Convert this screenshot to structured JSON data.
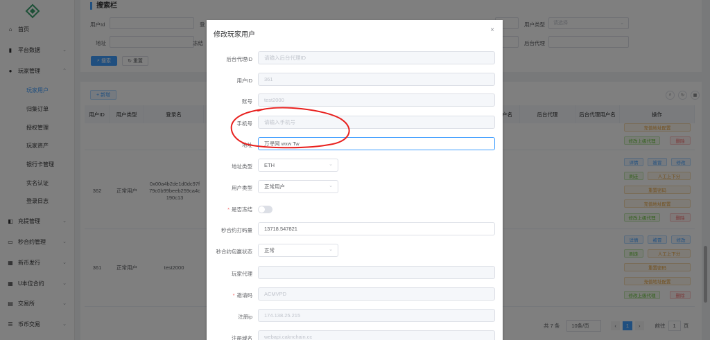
{
  "sidebar": {
    "items": [
      {
        "label": "首页",
        "icon": "home-icon",
        "glyph": "⌂"
      },
      {
        "label": "平台数据",
        "icon": "data-icon",
        "glyph": "▮"
      },
      {
        "label": "玩家管理",
        "icon": "user-icon",
        "glyph": "●"
      }
    ],
    "submenu": [
      {
        "label": "玩家用户"
      },
      {
        "label": "归集订单"
      },
      {
        "label": "授权管理"
      },
      {
        "label": "玩家资产"
      },
      {
        "label": "银行卡管理"
      },
      {
        "label": "实名认证"
      },
      {
        "label": "登录日志"
      }
    ],
    "items2": [
      {
        "label": "充提管理",
        "icon": "wallet-icon",
        "glyph": "◧"
      },
      {
        "label": "秒合约管理",
        "icon": "contract-icon",
        "glyph": "▭"
      },
      {
        "label": "新币发行",
        "icon": "coin-icon",
        "glyph": "▦"
      },
      {
        "label": "U本位合约",
        "icon": "grid-icon",
        "glyph": "▦"
      },
      {
        "label": "交易所",
        "icon": "exchange-icon",
        "glyph": "▤"
      },
      {
        "label": "币币交易",
        "icon": "list-icon",
        "glyph": "☰"
      }
    ]
  },
  "search": {
    "title": "搜索栏",
    "user_id_label": "用户Id",
    "address_label": "地址",
    "login_label": "登",
    "freeze_label": "冻结",
    "user_type_label": "用户类型",
    "user_type_placeholder": "请选择",
    "backend_agent_label": "后台代理",
    "search_btn": "搜索",
    "reset_btn": "重置"
  },
  "table": {
    "add_btn": "+ 新增",
    "headers": [
      "用户ID",
      "用户类型",
      "登录名",
      "户名",
      "后台代理",
      "后台代理用户名",
      "操作"
    ],
    "rows": [
      {
        "id": "362",
        "type": "正常用户",
        "login": "0x00a4b2de1d0dc97f79c0b99beeb259ca4c190c13"
      },
      {
        "id": "361",
        "type": "正常用户",
        "login": "test2000"
      }
    ],
    "ops": {
      "detail": "详情",
      "topup": "被冒",
      "edit": "修改",
      "sub": "刷走",
      "manual": "人工上下分",
      "reset_pwd": "重置密码",
      "set_addr": "充值地址配置",
      "edit_agent": "修改上级代理",
      "delete": "删除"
    }
  },
  "pager": {
    "total": "共 7 条",
    "size": "10条/页",
    "page": "1",
    "goto": "前往",
    "goto_page": "1",
    "unit": "页"
  },
  "dialog": {
    "title": "修改玩家用户",
    "fields": {
      "backend_agent_id": {
        "label": "后台代理ID",
        "placeholder": "请输入后台代理ID"
      },
      "user_id": {
        "label": "用户ID",
        "value": "361"
      },
      "account": {
        "label": "账号",
        "value": "test2000"
      },
      "phone": {
        "label": "手机号",
        "placeholder": "请输入手机号"
      },
      "address": {
        "label": "地址",
        "value": "万寻网 wxw Tw"
      },
      "address_type": {
        "label": "地址类型",
        "value": "ETH"
      },
      "user_type": {
        "label": "用户类型",
        "value": "正常用户"
      },
      "is_frozen": {
        "label": "是否冻结"
      },
      "sec_contract_bet": {
        "label": "秒合约打码量",
        "value": "13718.547821"
      },
      "sec_contract_status": {
        "label": "秒合约包赢状态",
        "value": "正常"
      },
      "player_agent": {
        "label": "玩家代理",
        "value": ""
      },
      "invite_code": {
        "label": "邀请码",
        "value": "ACMVPD"
      },
      "register_ip": {
        "label": "注册ip",
        "value": "174.138.25.215"
      },
      "register_domain": {
        "label": "注册域名",
        "value": "webapi.caknchain.cc"
      }
    }
  },
  "annotation_color": "#e8201e"
}
